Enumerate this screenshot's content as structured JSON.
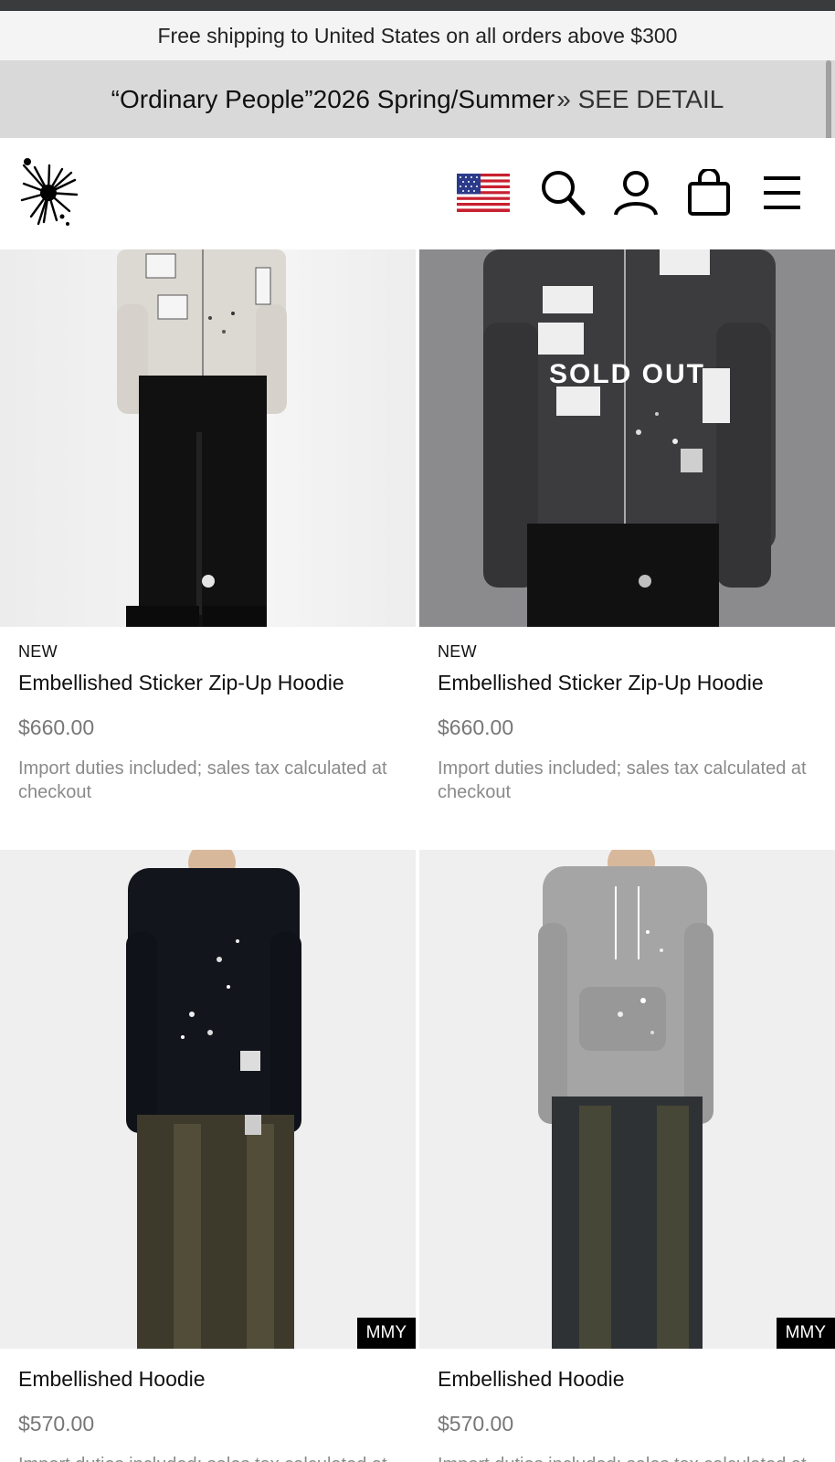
{
  "announcement": {
    "text": "Free shipping to United States on all orders above $300"
  },
  "promo": {
    "headline": "“Ordinary People”2026 Spring/Summer",
    "link_label": "» SEE DETAIL"
  },
  "header": {
    "icons": [
      "us-flag-icon",
      "search-icon",
      "account-icon",
      "cart-icon",
      "menu-icon"
    ]
  },
  "products": [
    {
      "badge": "NEW",
      "title": "Embellished Sticker Zip-Up Hoodie",
      "price": "$660.00",
      "note": "Import duties included; sales tax calculated at checkout",
      "overlay": "",
      "tag": ""
    },
    {
      "badge": "NEW",
      "title": "Embellished Sticker Zip-Up Hoodie",
      "price": "$660.00",
      "note": "Import duties included; sales tax calculated at checkout",
      "overlay": "SOLD OUT",
      "tag": ""
    },
    {
      "badge": "",
      "title": "Embellished Hoodie",
      "price": "$570.00",
      "note": "Import duties included; sales tax calculated at checkout",
      "overlay": "",
      "tag": "MMY"
    },
    {
      "badge": "",
      "title": "Embellished Hoodie",
      "price": "$570.00",
      "note": "Import duties included; sales tax calculated at checkout",
      "overlay": "",
      "tag": "MMY"
    }
  ],
  "colors": {
    "announcement_bg": "#f4f4f4",
    "promo_bg": "#d9d9d9",
    "price": "#777777",
    "note": "#8a8a8a"
  }
}
